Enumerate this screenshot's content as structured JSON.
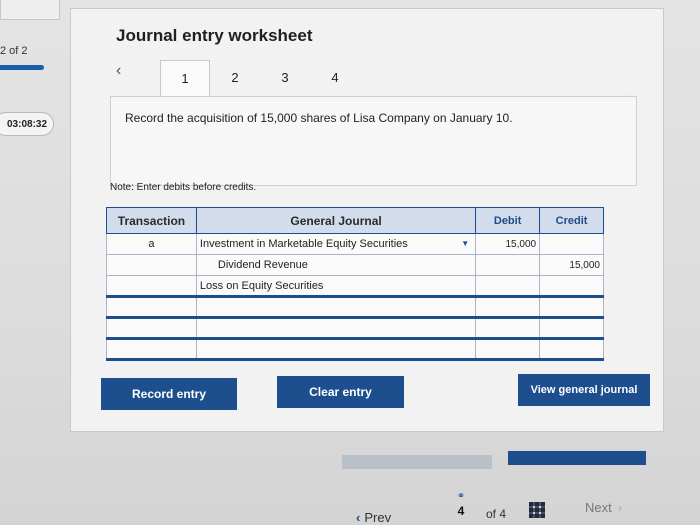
{
  "sidebar": {
    "question_counter": "2 of 2",
    "timer": "03:08:32"
  },
  "header": {
    "title": "Journal entry worksheet"
  },
  "tabs": [
    "1",
    "2",
    "3",
    "4"
  ],
  "active_tab": "1",
  "prompt": "Record the acquisition of 15,000 shares of Lisa Company on January 10.",
  "note": "Note: Enter debits before credits.",
  "table": {
    "headers": {
      "transaction": "Transaction",
      "general_journal": "General Journal",
      "debit": "Debit",
      "credit": "Credit"
    },
    "rows": [
      {
        "transaction": "a",
        "account": "Investment in Marketable Equity Securities",
        "debit": "15,000",
        "credit": ""
      },
      {
        "transaction": "",
        "account": "Dividend Revenue",
        "debit": "",
        "credit": "15,000"
      },
      {
        "transaction": "",
        "account": "Loss on Equity Securities",
        "debit": "",
        "credit": ""
      },
      {
        "transaction": "",
        "account": "",
        "debit": "",
        "credit": ""
      },
      {
        "transaction": "",
        "account": "",
        "debit": "",
        "credit": ""
      },
      {
        "transaction": "",
        "account": "",
        "debit": "",
        "credit": ""
      }
    ]
  },
  "buttons": {
    "record": "Record entry",
    "clear": "Clear entry",
    "view": "View general journal"
  },
  "footer": {
    "prev": "Prev",
    "page": "4",
    "of": "of 4",
    "next": "Next"
  },
  "colors": {
    "accent": "#1d4f8e",
    "header_bg": "#d2dcec"
  },
  "icons": {
    "prev": "chevron-left-icon",
    "next": "chevron-right-icon",
    "dropdown": "dropdown-arrow-icon",
    "grid": "grid-icon",
    "link": "link-icon"
  }
}
